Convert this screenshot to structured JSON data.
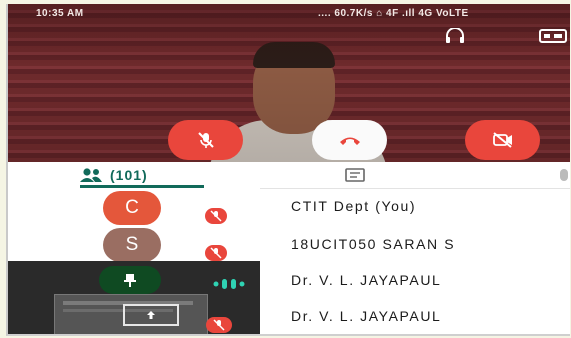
{
  "status_bar": {
    "time": "10:35 AM",
    "network": ".... 60.7K/s  ⌂  4F  .ıll  4G VoLTE"
  },
  "call_controls": {
    "mute_state": "muted",
    "camera_state": "off"
  },
  "colors": {
    "accent": "#116a5a",
    "danger": "#e9463c",
    "avatar_c": "#e4573b",
    "avatar_s": "#9a6e62",
    "pin_bubble": "#0f4a22"
  },
  "tabs": {
    "participants_count": "(101)",
    "participants_icon": "people-icon",
    "chat_icon": "chat-icon",
    "active_tab": "participants"
  },
  "participants": [
    {
      "avatar_letter": "C",
      "name": "CTIT Dept (You)",
      "muted": true
    },
    {
      "avatar_letter": "S",
      "name": "18UCIT050 SARAN S",
      "muted": true
    },
    {
      "avatar_letter": "",
      "name": "Dr. V. L. JAYAPAUL",
      "muted": false,
      "pinned": true,
      "speaking": true
    },
    {
      "avatar_letter": "",
      "name": "Dr. V. L. JAYAPAUL",
      "muted": true,
      "presenting": true
    }
  ]
}
